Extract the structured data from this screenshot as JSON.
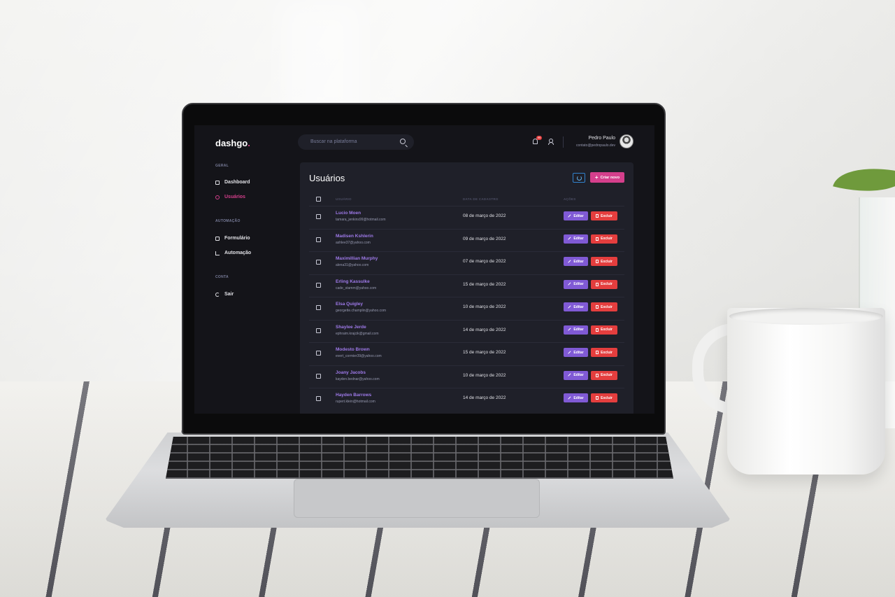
{
  "app": {
    "logo": "dashgo",
    "logo_dot": "."
  },
  "header": {
    "search_placeholder": "Buscar na plataforma",
    "notification_count": "99",
    "user_name": "Pedro Paulo",
    "user_email": "contato@pedropaulo.dev"
  },
  "sidebar": {
    "sections": [
      {
        "title": "GERAL",
        "items": [
          {
            "label": "Dashboard",
            "icon": "dashboard-icon"
          },
          {
            "label": "Usuários",
            "icon": "users-icon",
            "active": true
          }
        ]
      },
      {
        "title": "AUTOMAÇÃO",
        "items": [
          {
            "label": "Formulário",
            "icon": "form-icon"
          },
          {
            "label": "Automação",
            "icon": "automation-icon"
          }
        ]
      },
      {
        "title": "CONTA",
        "items": [
          {
            "label": "Sair",
            "icon": "logout-icon"
          }
        ]
      }
    ]
  },
  "main": {
    "title": "Usuários",
    "create_label": "Criar novo",
    "columns": [
      "USUÁRIO",
      "DATA DE CADASTRO",
      "AÇÕES"
    ],
    "edit_label": "Editar",
    "delete_label": "Excluir",
    "rows": [
      {
        "name": "Lucio Moen",
        "email": "tamara_jenkins99@hotmail.com",
        "date": "08 de março de 2022"
      },
      {
        "name": "Madisen Kshlerin",
        "email": "ashlee37@yahoo.com",
        "date": "09 de março de 2022"
      },
      {
        "name": "Maximillian Murphy",
        "email": "alena31@yahoo.com",
        "date": "07 de março de 2022"
      },
      {
        "name": "Erling Kassulke",
        "email": "cade_stamm@yahoo.com",
        "date": "15 de março de 2022"
      },
      {
        "name": "Elsa Quigley",
        "email": "georgette.champlin@yahoo.com",
        "date": "10 de março de 2022"
      },
      {
        "name": "Shaylee Jerde",
        "email": "ephraim.krajcik@gmail.com",
        "date": "14 de março de 2022"
      },
      {
        "name": "Modesto Brown",
        "email": "evert_cormier39@yahoo.com",
        "date": "15 de março de 2022"
      },
      {
        "name": "Joany Jacobs",
        "email": "kayden.bednar@yahoo.com",
        "date": "10 de março de 2022"
      },
      {
        "name": "Hayden Barrows",
        "email": "rupert.klein@hotmail.com",
        "date": "14 de março de 2022"
      }
    ]
  },
  "colors": {
    "background": "#141419",
    "panel": "#1f2029",
    "accent_pink": "#d53f8c",
    "accent_purple": "#805ad5",
    "danger": "#e53e3e"
  }
}
